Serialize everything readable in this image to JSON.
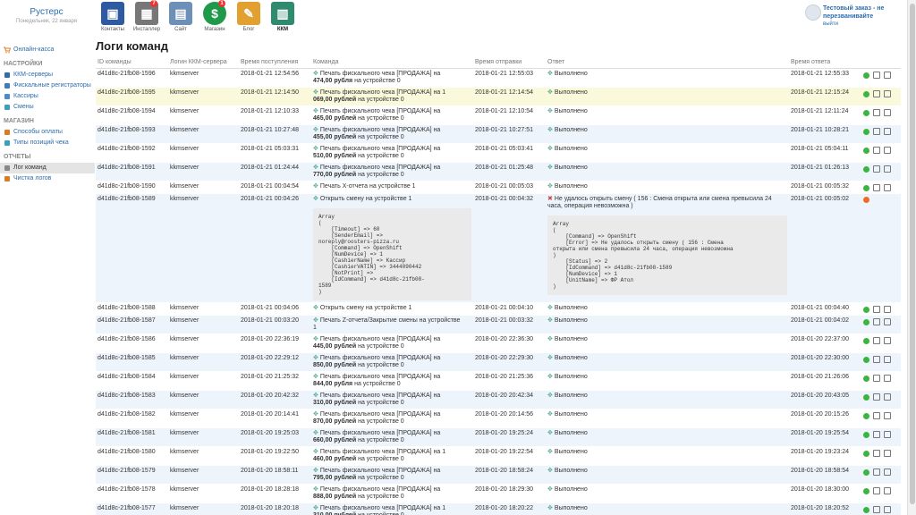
{
  "brand": {
    "name": "Рустерс",
    "date": "Понедельник, 22 января"
  },
  "apps": [
    {
      "label": "Контакты",
      "icon": "contacts-icon",
      "badge": "",
      "color": "#2d5aa0"
    },
    {
      "label": "Инсталлер",
      "icon": "installer-icon",
      "badge": "7",
      "color": "#777777"
    },
    {
      "label": "Сайт",
      "icon": "site-icon",
      "badge": "",
      "color": "#6c90b8"
    },
    {
      "label": "Магазин",
      "icon": "store-icon",
      "badge": "1",
      "color": "#1f9a4a"
    },
    {
      "label": "Блог",
      "icon": "blog-icon",
      "badge": "",
      "color": "#e2a030"
    },
    {
      "label": "ККМ",
      "icon": "kkm-icon",
      "badge": "",
      "color": "#2e8b6e"
    }
  ],
  "user": {
    "name": "Тестовый заказ - не перезванивайте",
    "logout": "выйти"
  },
  "sidebar": {
    "top_link": "Онлайн-касса",
    "sections": [
      {
        "title": "НАСТРОЙКИ",
        "items": [
          {
            "label": "ККМ-серверы",
            "icon": "server-icon"
          },
          {
            "label": "Фискальные регистраторы",
            "icon": "register-icon"
          },
          {
            "label": "Кассиры",
            "icon": "cashier-icon"
          },
          {
            "label": "Смены",
            "icon": "shift-icon"
          }
        ]
      },
      {
        "title": "МАГАЗИН",
        "items": [
          {
            "label": "Способы оплаты",
            "icon": "payment-icon"
          },
          {
            "label": "Типы позиций чека",
            "icon": "tag-icon"
          }
        ]
      },
      {
        "title": "ОТЧЕТЫ",
        "items": [
          {
            "label": "Лог команд",
            "icon": "log-icon",
            "active": true
          },
          {
            "label": "Чистка логов",
            "icon": "broom-icon"
          }
        ]
      }
    ]
  },
  "page_title": "Логи команд",
  "table": {
    "headers": [
      "ID команды",
      "Логин ККМ-сервера",
      "Время поступления",
      "Команда",
      "Время отправки",
      "Ответ",
      "Время ответа"
    ],
    "rows": [
      {
        "id": "d41d8c-21fb08-1596",
        "login": "kkmserver",
        "received": "2018-01-21 12:54:56",
        "cmd_pre": "Печать фискального чека [ПРОДАЖА] на",
        "amount": "474,00 рубля",
        "cmd_post": "на устройстве 0",
        "sent": "2018-01-21 12:55:03",
        "answer": "Выполнено",
        "answered": "2018-01-21 12:55:33",
        "status": "ok"
      },
      {
        "id": "d41d8c-21fb08-1595",
        "login": "kkmserver",
        "received": "2018-01-21 12:14:50",
        "cmd_pre": "Печать фискального чека [ПРОДАЖА] на 1",
        "amount": "069,00 рублей",
        "cmd_post": "на устройстве 0",
        "sent": "2018-01-21 12:14:54",
        "answer": "Выполнено",
        "answered": "2018-01-21 12:15:24",
        "status": "ok",
        "highlight": true
      },
      {
        "id": "d41d8c-21fb08-1594",
        "login": "kkmserver",
        "received": "2018-01-21 12:10:33",
        "cmd_pre": "Печать фискального чека [ПРОДАЖА] на",
        "amount": "465,00 рублей",
        "cmd_post": "на устройстве 0",
        "sent": "2018-01-21 12:10:54",
        "answer": "Выполнено",
        "answered": "2018-01-21 12:11:24",
        "status": "ok"
      },
      {
        "id": "d41d8c-21fb08-1593",
        "login": "kkmserver",
        "received": "2018-01-21 10:27:48",
        "cmd_pre": "Печать фискального чека [ПРОДАЖА] на",
        "amount": "455,00 рублей",
        "cmd_post": "на устройстве 0",
        "sent": "2018-01-21 10:27:51",
        "answer": "Выполнено",
        "answered": "2018-01-21 10:28:21",
        "status": "ok"
      },
      {
        "id": "d41d8c-21fb08-1592",
        "login": "kkmserver",
        "received": "2018-01-21 05:03:31",
        "cmd_pre": "Печать фискального чека [ПРОДАЖА] на",
        "amount": "510,00 рублей",
        "cmd_post": "на устройстве 0",
        "sent": "2018-01-21 05:03:41",
        "answer": "Выполнено",
        "answered": "2018-01-21 05:04:11",
        "status": "ok"
      },
      {
        "id": "d41d8c-21fb08-1591",
        "login": "kkmserver",
        "received": "2018-01-21 01:24:44",
        "cmd_pre": "Печать фискального чека [ПРОДАЖА] на",
        "amount": "770,00 рублей",
        "cmd_post": "на устройстве 0",
        "sent": "2018-01-21 01:25:48",
        "answer": "Выполнено",
        "answered": "2018-01-21 01:26:13",
        "status": "ok"
      },
      {
        "id": "d41d8c-21fb08-1590",
        "login": "kkmserver",
        "received": "2018-01-21 00:04:54",
        "cmd_pre": "Печать X-отчета на устройстве 1",
        "amount": "",
        "cmd_post": "",
        "sent": "2018-01-21 00:05:03",
        "answer": "Выполнено",
        "answered": "2018-01-21 00:05:32",
        "status": "ok",
        "single": true
      },
      {
        "id": "d41d8c-21fb08-1589",
        "login": "kkmserver",
        "received": "2018-01-21 00:04:26",
        "cmd_pre": "Открыть смену на устройстве 1",
        "amount": "",
        "cmd_post": "",
        "sent": "2018-01-21 00:04:32",
        "answer": "Не удалось открыть смену ( 156 : Смена открыта или смена превысила 24 часа, операция невозможна )",
        "answered": "2018-01-21 00:05:02",
        "status": "err",
        "error": true,
        "cmd_dump": "Array\n(\n    [Timeout] => 60\n    [SenderEmail] =>\nnoreply@roosters-pizza.ru\n    [Command] => OpenShift\n    [NumDevice] => 1\n    [CashierName] => Кассир\n    [CashierVATIN] => 3444090442\n    [NotPrint] =>\n    [IdCommand] => d41d8c-21fb08-\n1589\n)",
        "answer_dump": "Array\n(\n    [Command] => OpenShift\n    [Error] => Не удалось открыть смену ( 156 : Смена\nоткрыта или смена превысила 24 часа, операция невозможна\n)\n    [Status] => 2\n    [IdCommand] => d41d8c-21fb08-1589\n    [NumDevice] => 1\n    [UnitName] => ФР Атол\n)"
      },
      {
        "id": "d41d8c-21fb08-1588",
        "login": "kkmserver",
        "received": "2018-01-21 00:04:06",
        "cmd_pre": "Открыть смену на устройстве 1",
        "amount": "",
        "cmd_post": "",
        "sent": "2018-01-21 00:04:10",
        "answer": "Выполнено",
        "answered": "2018-01-21 00:04:40",
        "status": "ok",
        "single": true
      },
      {
        "id": "d41d8c-21fb08-1587",
        "login": "kkmserver",
        "received": "2018-01-21 00:03:20",
        "cmd_pre": "Печать Z-отчета/Закрытие смены на устройстве",
        "amount": "",
        "cmd_post": "1",
        "sent": "2018-01-21 00:03:32",
        "answer": "Выполнено",
        "answered": "2018-01-21 00:04:02",
        "status": "ok"
      },
      {
        "id": "d41d8c-21fb08-1586",
        "login": "kkmserver",
        "received": "2018-01-20 22:36:19",
        "cmd_pre": "Печать фискального чека [ПРОДАЖА] на",
        "amount": "445,00 рублей",
        "cmd_post": "на устройстве 0",
        "sent": "2018-01-20 22:36:30",
        "answer": "Выполнено",
        "answered": "2018-01-20 22:37:00",
        "status": "ok"
      },
      {
        "id": "d41d8c-21fb08-1585",
        "login": "kkmserver",
        "received": "2018-01-20 22:29:12",
        "cmd_pre": "Печать фискального чека [ПРОДАЖА] на",
        "amount": "850,00 рублей",
        "cmd_post": "на устройстве 0",
        "sent": "2018-01-20 22:29:30",
        "answer": "Выполнено",
        "answered": "2018-01-20 22:30:00",
        "status": "ok"
      },
      {
        "id": "d41d8c-21fb08-1584",
        "login": "kkmserver",
        "received": "2018-01-20 21:25:32",
        "cmd_pre": "Печать фискального чека [ПРОДАЖА] на",
        "amount": "844,00 рубля",
        "cmd_post": "на устройстве 0",
        "sent": "2018-01-20 21:25:36",
        "answer": "Выполнено",
        "answered": "2018-01-20 21:26:06",
        "status": "ok"
      },
      {
        "id": "d41d8c-21fb08-1583",
        "login": "kkmserver",
        "received": "2018-01-20 20:42:32",
        "cmd_pre": "Печать фискального чека [ПРОДАЖА] на",
        "amount": "310,00 рублей",
        "cmd_post": "на устройстве 0",
        "sent": "2018-01-20 20:42:34",
        "answer": "Выполнено",
        "answered": "2018-01-20 20:43:05",
        "status": "ok"
      },
      {
        "id": "d41d8c-21fb08-1582",
        "login": "kkmserver",
        "received": "2018-01-20 20:14:41",
        "cmd_pre": "Печать фискального чека [ПРОДАЖА] на",
        "amount": "870,00 рублей",
        "cmd_post": "на устройстве 0",
        "sent": "2018-01-20 20:14:56",
        "answer": "Выполнено",
        "answered": "2018-01-20 20:15:26",
        "status": "ok"
      },
      {
        "id": "d41d8c-21fb08-1581",
        "login": "kkmserver",
        "received": "2018-01-20 19:25:03",
        "cmd_pre": "Печать фискального чека [ПРОДАЖА] на",
        "amount": "660,00 рублей",
        "cmd_post": "на устройстве 0",
        "sent": "2018-01-20 19:25:24",
        "answer": "Выполнено",
        "answered": "2018-01-20 19:25:54",
        "status": "ok"
      },
      {
        "id": "d41d8c-21fb08-1580",
        "login": "kkmserver",
        "received": "2018-01-20 19:22:50",
        "cmd_pre": "Печать фискального чека [ПРОДАЖА] на 1",
        "amount": "460,00 рублей",
        "cmd_post": "на устройстве 0",
        "sent": "2018-01-20 19:22:54",
        "answer": "Выполнено",
        "answered": "2018-01-20 19:23:24",
        "status": "ok"
      },
      {
        "id": "d41d8c-21fb08-1579",
        "login": "kkmserver",
        "received": "2018-01-20 18:58:11",
        "cmd_pre": "Печать фискального чека [ПРОДАЖА] на",
        "amount": "795,00 рублей",
        "cmd_post": "на устройстве 0",
        "sent": "2018-01-20 18:58:24",
        "answer": "Выполнено",
        "answered": "2018-01-20 18:58:54",
        "status": "ok"
      },
      {
        "id": "d41d8c-21fb08-1578",
        "login": "kkmserver",
        "received": "2018-01-20 18:28:18",
        "cmd_pre": "Печать фискального чека [ПРОДАЖА] на",
        "amount": "888,00 рублей",
        "cmd_post": "на устройстве 0",
        "sent": "2018-01-20 18:29:30",
        "answer": "Выполнено",
        "answered": "2018-01-20 18:30:00",
        "status": "ok"
      },
      {
        "id": "d41d8c-21fb08-1577",
        "login": "kkmserver",
        "received": "2018-01-20 18:20:18",
        "cmd_pre": "Печать фискального чека [ПРОДАЖА] на 1",
        "amount": "310,00 рублей",
        "cmd_post": "на устройстве 0",
        "sent": "2018-01-20 18:20:22",
        "answer": "Выполнено",
        "answered": "2018-01-20 18:20:52",
        "status": "ok"
      }
    ]
  }
}
